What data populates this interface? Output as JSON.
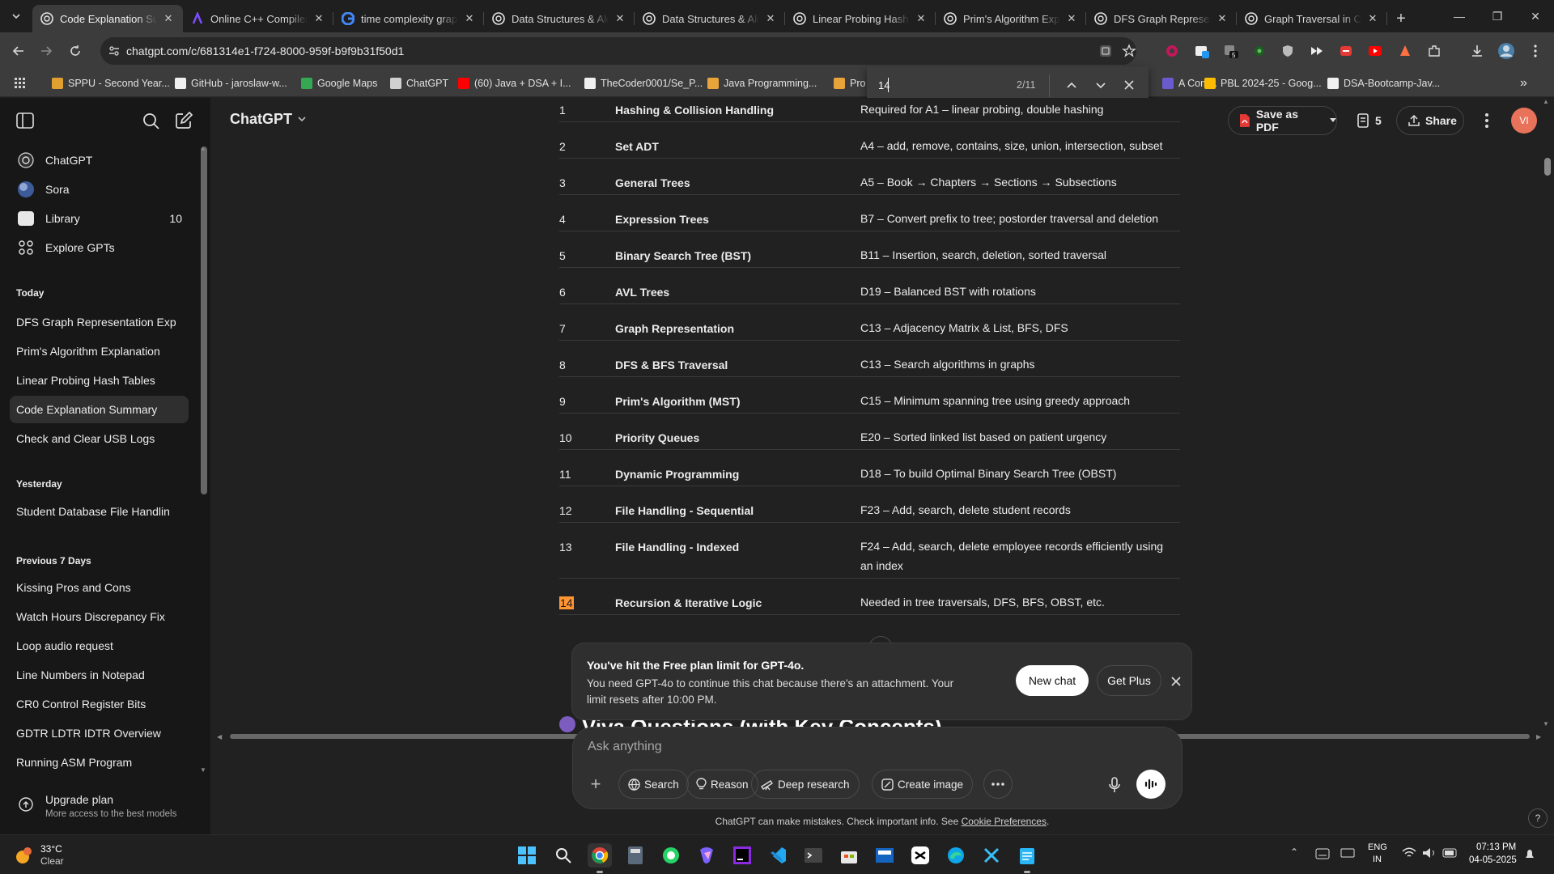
{
  "tabs": [
    {
      "title": "Code Explanation Summary",
      "active": true,
      "icon": "chatgpt-icon"
    },
    {
      "title": "Online C++ Compiler",
      "active": false,
      "icon": "compiler-icon"
    },
    {
      "title": "time complexity graph",
      "active": false,
      "icon": "google-icon"
    },
    {
      "title": "Data Structures & Algorithms",
      "active": false,
      "icon": "chatgpt-icon"
    },
    {
      "title": "Data Structures & Algorithms",
      "active": false,
      "icon": "chatgpt-icon"
    },
    {
      "title": "Linear Probing Hash Tables",
      "active": false,
      "icon": "chatgpt-icon"
    },
    {
      "title": "Prim's Algorithm Explanation",
      "active": false,
      "icon": "chatgpt-icon"
    },
    {
      "title": "DFS Graph Representation",
      "active": false,
      "icon": "chatgpt-icon"
    },
    {
      "title": "Graph Traversal in C++",
      "active": false,
      "icon": "chatgpt-icon"
    }
  ],
  "url": "chatgpt.com/c/681314e1-f724-8000-959f-b9f9b31f50d1",
  "bookmarks": [
    {
      "label": "SPPU - Second Year...",
      "color": "#e0a030"
    },
    {
      "label": "GitHub - jaroslaw-w...",
      "color": "#f0f0f0"
    },
    {
      "label": "Google Maps",
      "color": "#34a853"
    },
    {
      "label": "ChatGPT",
      "color": "#d0d0d0"
    },
    {
      "label": "(60) Java + DSA + I...",
      "color": "#ff0000"
    },
    {
      "label": "TheCoder0001/Se_P...",
      "color": "#f0f0f0"
    },
    {
      "label": "Java Programming...",
      "color": "#e8a33a"
    },
    {
      "label": "Pro",
      "color": "#e8a33a"
    },
    {
      "label": "A Com...",
      "color": "#6a5acd"
    },
    {
      "label": "PBL 2024-25 - Goog...",
      "color": "#fbbc04"
    },
    {
      "label": "DSA-Bootcamp-Jav...",
      "color": "#f0f0f0"
    }
  ],
  "find": {
    "query": "14",
    "count": "2/11"
  },
  "sidebar": {
    "top_items": [
      {
        "label": "ChatGPT",
        "icon": "chatgpt-icon"
      },
      {
        "label": "Sora",
        "icon": "sora-icon"
      },
      {
        "label": "Library",
        "icon": "library-icon",
        "badge": "10"
      },
      {
        "label": "Explore GPTs",
        "icon": "grid-icon"
      }
    ],
    "sections": [
      {
        "title": "Today",
        "items": [
          "DFS Graph Representation Exp",
          "Prim's Algorithm Explanation",
          "Linear Probing Hash Tables",
          "Code Explanation Summary",
          "Check and Clear USB Logs"
        ]
      },
      {
        "title": "Yesterday",
        "items": [
          "Student Database File Handlin"
        ]
      },
      {
        "title": "Previous 7 Days",
        "items": [
          "Kissing Pros and Cons",
          "Watch Hours Discrepancy Fix",
          "Loop audio request",
          "Line Numbers in Notepad",
          "CR0 Control Register Bits",
          "GDTR LDTR IDTR Overview",
          "Running ASM Program"
        ]
      }
    ],
    "upgrade": {
      "title": "Upgrade plan",
      "subtitle": "More access to the best models"
    }
  },
  "header": {
    "model": "ChatGPT",
    "save_pdf": "Save as PDF",
    "count": "5",
    "share": "Share",
    "avatar": "VI"
  },
  "table_rows": [
    {
      "num": "1",
      "topic": "Hashing & Collision Handling",
      "use": "Required for A1 – linear probing, double hashing"
    },
    {
      "num": "2",
      "topic": "Set ADT",
      "use": "A4 – add, remove, contains, size, union, intersection, subset"
    },
    {
      "num": "3",
      "topic": "General Trees",
      "use": "A5 – Book → Chapters → Sections → Subsections"
    },
    {
      "num": "4",
      "topic": "Expression Trees",
      "use": "B7 – Convert prefix to tree; postorder traversal and deletion"
    },
    {
      "num": "5",
      "topic": "Binary Search Tree (BST)",
      "use": "B11 – Insertion, search, deletion, sorted traversal"
    },
    {
      "num": "6",
      "topic": "AVL Trees",
      "use": "D19 – Balanced BST with rotations"
    },
    {
      "num": "7",
      "topic": "Graph Representation",
      "use": "C13 – Adjacency Matrix & List, BFS, DFS"
    },
    {
      "num": "8",
      "topic": "DFS & BFS Traversal",
      "use": "C13 – Search algorithms in graphs"
    },
    {
      "num": "9",
      "topic": "Prim's Algorithm (MST)",
      "use": "C15 – Minimum spanning tree using greedy approach"
    },
    {
      "num": "10",
      "topic": "Priority Queues",
      "use": "E20 – Sorted linked list based on patient urgency"
    },
    {
      "num": "11",
      "topic": "Dynamic Programming",
      "use": "D18 – To build Optimal Binary Search Tree (OBST)"
    },
    {
      "num": "12",
      "topic": "File Handling - Sequential",
      "use": "F23 – Add, search, delete student records"
    },
    {
      "num": "13",
      "topic": "File Handling - Indexed",
      "use": "F24 – Add, search, delete employee records efficiently using an index"
    },
    {
      "num": "14",
      "topic": "Recursion & Iterative Logic",
      "use": "Needed in tree traversals, DFS, BFS, OBST, etc."
    }
  ],
  "next_heading": "Viva Questions (with Key Concepts)",
  "limit": {
    "title": "You've hit the Free plan limit for GPT-4o.",
    "body": "You need GPT-4o to continue this chat because there's an attachment. Your limit resets after 10:00 PM.",
    "new_chat": "New chat",
    "get_plus": "Get Plus"
  },
  "composer": {
    "placeholder": "Ask anything",
    "buttons": [
      "Search",
      "Reason",
      "Deep research",
      "Create image"
    ]
  },
  "disclaimer": {
    "text": "ChatGPT can make mistakes. Check important info. See ",
    "link": "Cookie Preferences",
    "end": "."
  },
  "weather": {
    "temp": "33°C",
    "cond": "Clear"
  },
  "tray": {
    "lang1": "ENG",
    "lang2": "IN",
    "time": "07:13 PM",
    "date": "04-05-2025"
  },
  "colors": {
    "accent_highlight": "#ff9632",
    "avatar_bg": "#e8735a",
    "pdf_red": "#e53935"
  }
}
